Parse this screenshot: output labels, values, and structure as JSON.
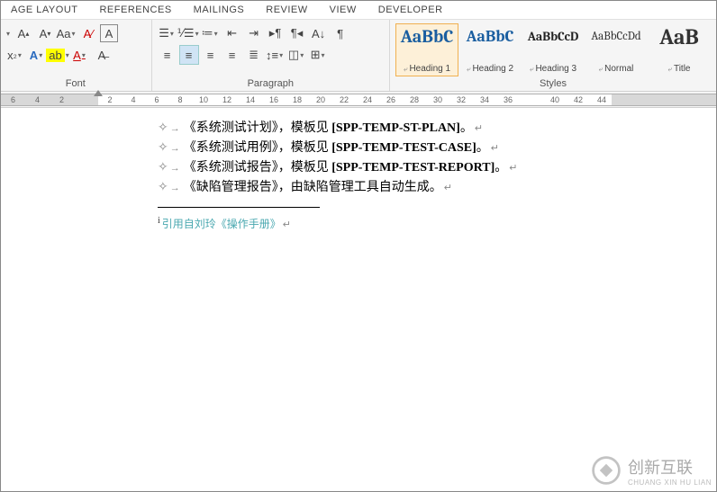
{
  "tabs": [
    "AGE LAYOUT",
    "REFERENCES",
    "MAILINGS",
    "REVIEW",
    "VIEW",
    "DEVELOPER"
  ],
  "groups": {
    "font": {
      "label": "Font"
    },
    "paragraph": {
      "label": "Paragraph"
    },
    "styles": {
      "label": "Styles"
    }
  },
  "styles": [
    {
      "preview": "AaBbC",
      "name": "Heading 1",
      "cls": "h1"
    },
    {
      "preview": "AaBbC",
      "name": "Heading 2",
      "cls": "h2"
    },
    {
      "preview": "AaBbCcD",
      "name": "Heading 3",
      "cls": "h3"
    },
    {
      "preview": "AaBbCcDd",
      "name": "Normal",
      "cls": "normal"
    },
    {
      "preview": "AaB",
      "name": "Title",
      "cls": "title"
    }
  ],
  "ruler_left": [
    "6",
    "4",
    "2",
    ""
  ],
  "ruler_right": [
    "2",
    "4",
    "6",
    "8",
    "10",
    "12",
    "14",
    "16",
    "18",
    "20",
    "22",
    "24",
    "26",
    "28",
    "30",
    "32",
    "34",
    "36",
    "",
    "40",
    "42",
    "44"
  ],
  "doc": {
    "lines": [
      {
        "pre": "《系统测试计划》，模板见 ",
        "bold": "[SPP-TEMP-ST-PLAN]",
        "post": "。"
      },
      {
        "pre": "《系统测试用例》，模板见 ",
        "bold": "[SPP-TEMP-TEST-CASE]",
        "post": "。"
      },
      {
        "pre": "《系统测试报告》，模板见 ",
        "bold": "[SPP-TEMP-TEST-REPORT]",
        "post": "。"
      },
      {
        "pre": "《缺陷管理报告》，由缺陷管理工具自动生成。",
        "bold": "",
        "post": ""
      }
    ],
    "footnote_mark": "i",
    "footnote": "引用自刘玲《操作手册》"
  },
  "watermark": {
    "main": "创新互联",
    "sub": "CHUANG XIN HU LIAN"
  }
}
